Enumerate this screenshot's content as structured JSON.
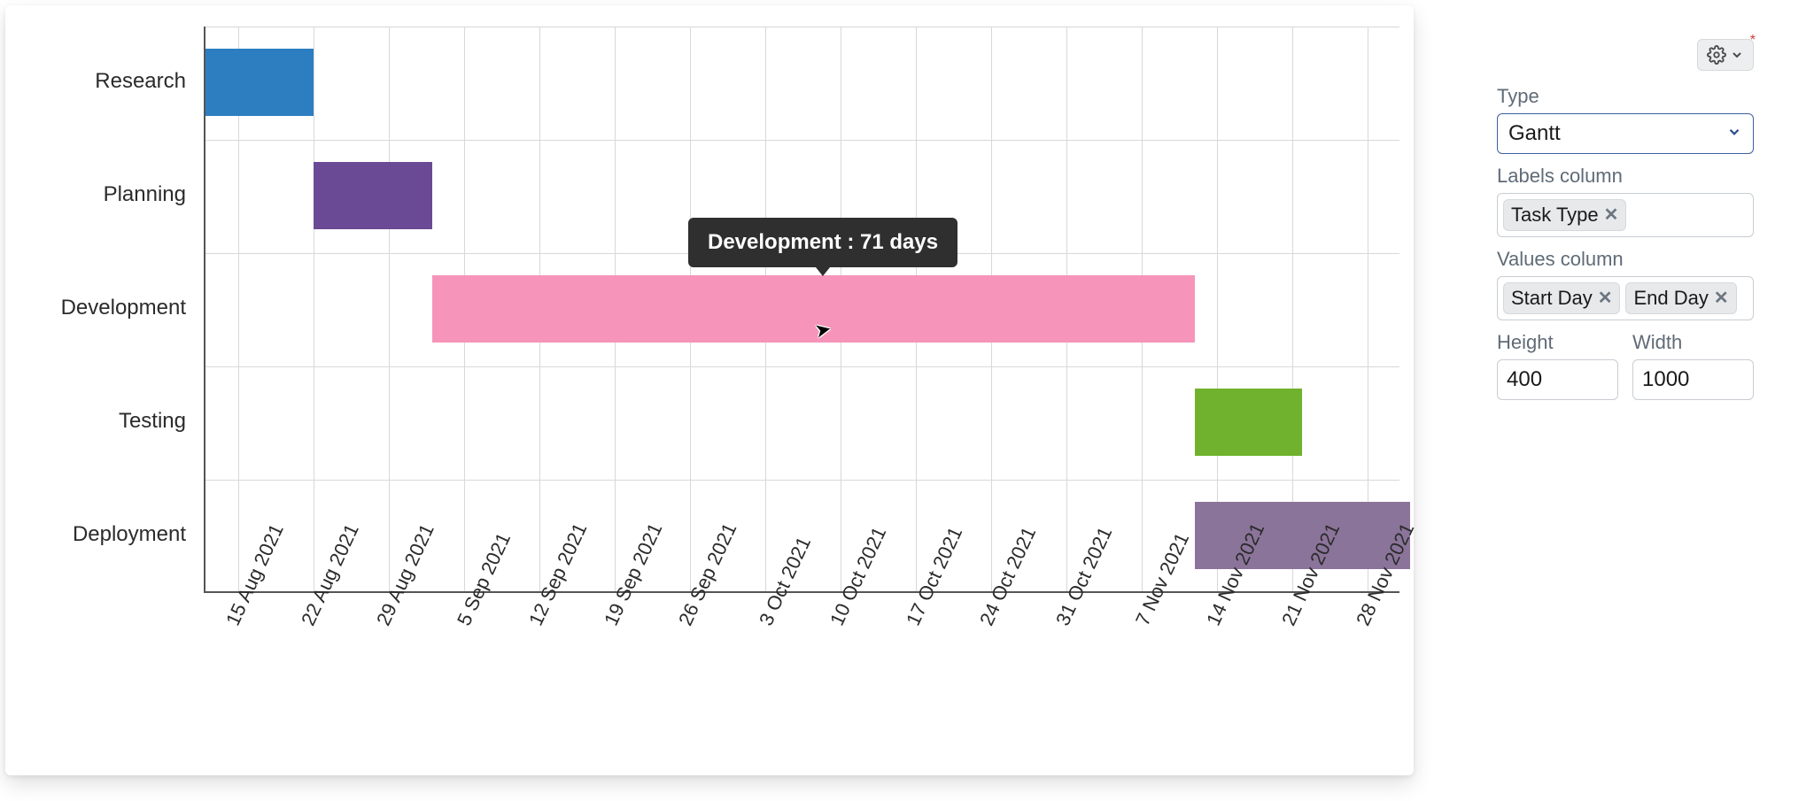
{
  "chart_data": {
    "type": "bar",
    "orientation": "horizontal-gantt",
    "x_ticks": [
      "15 Aug 2021",
      "22 Aug 2021",
      "29 Aug 2021",
      "5 Sep 2021",
      "12 Sep 2021",
      "19 Sep 2021",
      "26 Sep 2021",
      "3 Oct 2021",
      "10 Oct 2021",
      "17 Oct 2021",
      "24 Oct 2021",
      "31 Oct 2021",
      "7 Nov 2021",
      "14 Nov 2021",
      "21 Nov 2021",
      "28 Nov 2021"
    ],
    "y_categories": [
      "Research",
      "Planning",
      "Development",
      "Testing",
      "Deployment"
    ],
    "tasks": [
      {
        "label": "Research",
        "start": "12 Aug 2021",
        "end": "22 Aug 2021",
        "color": "#2d7ec1"
      },
      {
        "label": "Planning",
        "start": "22 Aug 2021",
        "end": "2 Sep 2021",
        "color": "#6b4a95"
      },
      {
        "label": "Development",
        "start": "2 Sep 2021",
        "end": "12 Nov 2021",
        "color": "#f694b9",
        "duration_days": 71
      },
      {
        "label": "Testing",
        "start": "12 Nov 2021",
        "end": "22 Nov 2021",
        "color": "#70b22e"
      },
      {
        "label": "Deployment",
        "start": "12 Nov 2021",
        "end": "2 Dec 2021",
        "color": "#8b749a"
      }
    ],
    "tooltip": "Development : 71 days"
  },
  "sidebar": {
    "type_label": "Type",
    "type_value": "Gantt",
    "labels_column_label": "Labels column",
    "labels_column_tag": "Task Type",
    "values_column_label": "Values column",
    "values_column_tags": [
      "Start Day",
      "End Day"
    ],
    "height_label": "Height",
    "height_value": "400",
    "width_label": "Width",
    "width_value": "1000"
  }
}
